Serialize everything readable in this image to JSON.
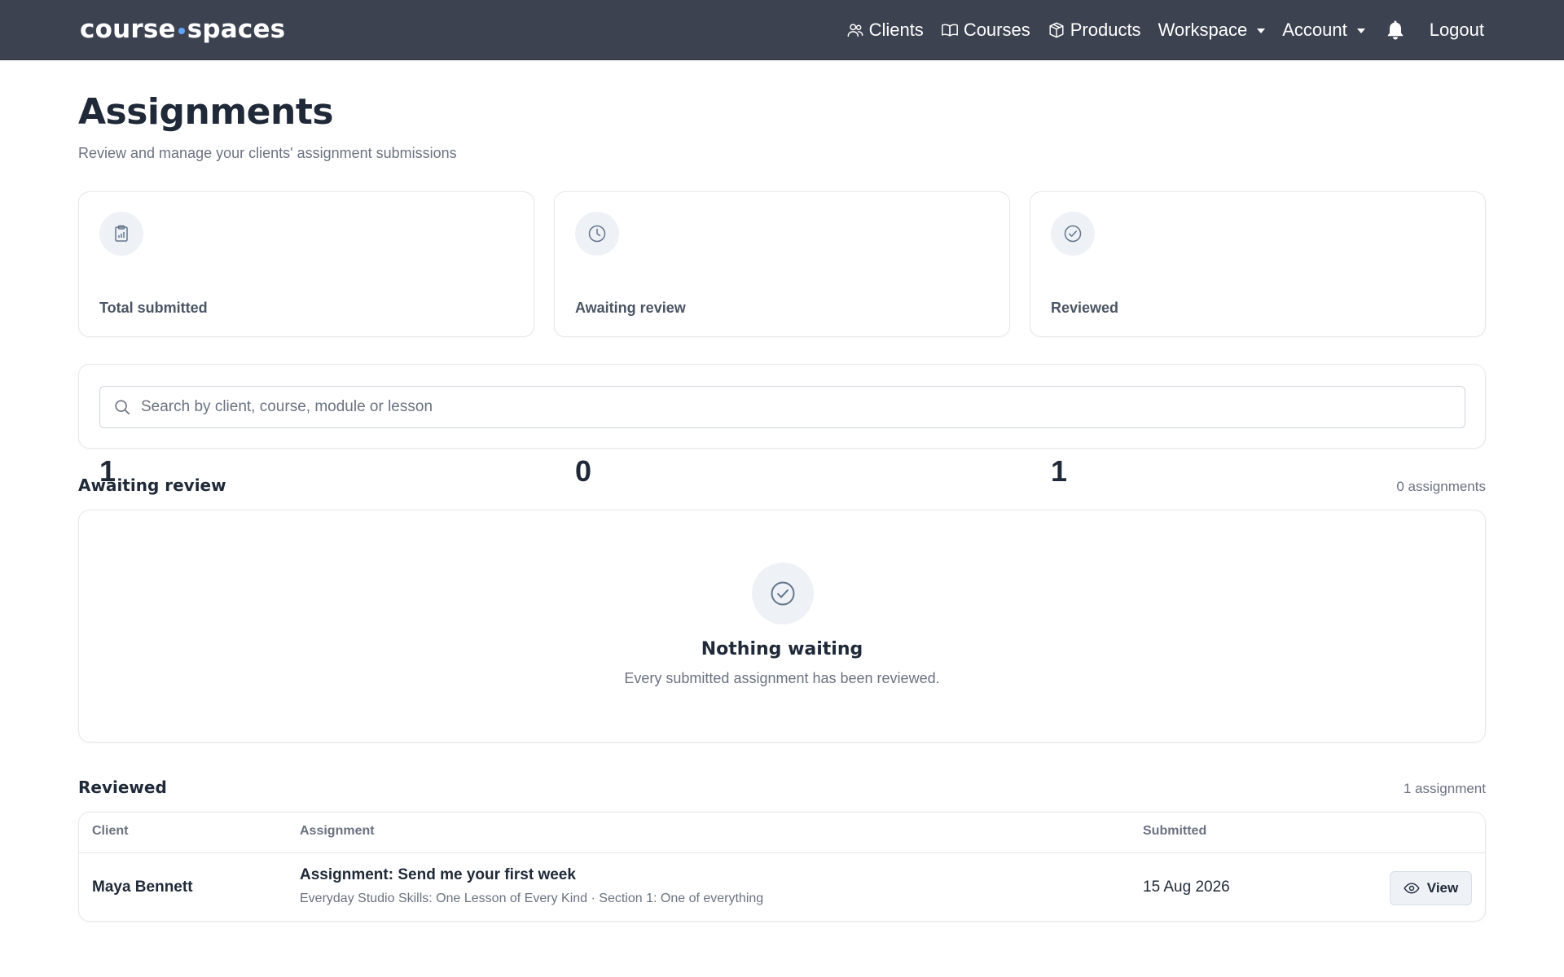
{
  "navbar": {
    "brand_left": "course",
    "brand_right": "spaces",
    "items": {
      "clients": "Clients",
      "courses": "Courses",
      "products": "Products",
      "workspace": "Workspace",
      "account": "Account",
      "logout": "Logout"
    },
    "icons": [
      "users-icon",
      "book-icon",
      "box-icon",
      "chevron-down-icon",
      "bell-icon"
    ]
  },
  "header": {
    "title": "Assignments",
    "subtitle": "Review and manage your clients' assignment submissions"
  },
  "stats": [
    {
      "value": "1",
      "label": "Total submitted",
      "icon": "clipboard-chart-icon"
    },
    {
      "value": "0",
      "label": "Awaiting review",
      "icon": "clock-icon"
    },
    {
      "value": "1",
      "label": "Reviewed",
      "icon": "check-circle-icon"
    }
  ],
  "search": {
    "placeholder": "Search by client, course, module or lesson",
    "value": ""
  },
  "awaiting": {
    "title": "Awaiting review",
    "count": "0 assignments",
    "empty_title": "Nothing waiting",
    "empty_text": "Every submitted assignment has been reviewed."
  },
  "reviewed": {
    "title": "Reviewed",
    "count": "1 assignment",
    "columns": {
      "client": "Client",
      "assignment": "Assignment",
      "submitted": "Submitted"
    },
    "rows": [
      {
        "client": "Maya Bennett",
        "assignment": "Assignment: Send me your first week",
        "context": "Everyday Studio Skills: One Lesson of Every Kind · Section 1: One of everything",
        "submitted": "15 Aug 2026",
        "action": "View"
      }
    ]
  },
  "colors": {
    "navbar_bg": "#3c4250",
    "accent_dot": "#60a5fa",
    "muted_text": "#6b7280",
    "border": "#e5e7eb"
  }
}
